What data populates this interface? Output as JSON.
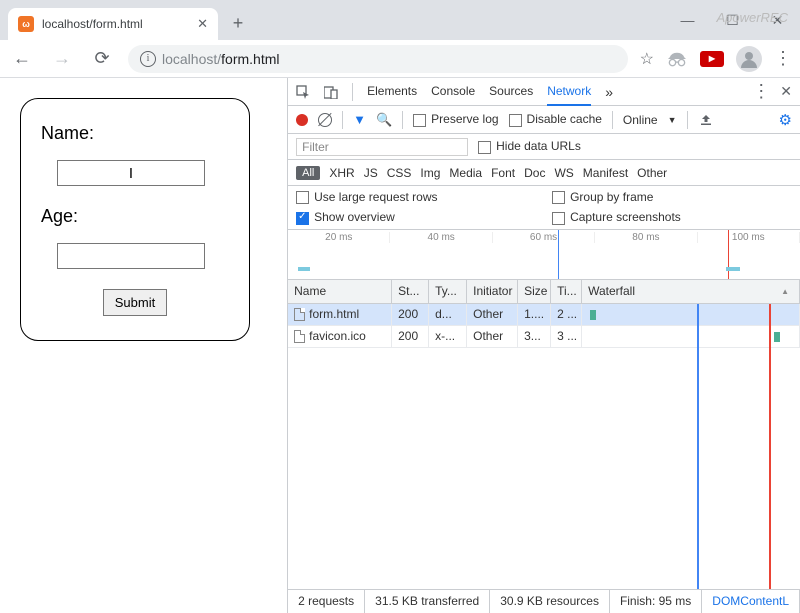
{
  "window": {
    "tab_title": "localhost/form.html",
    "watermark": "ApowerREC"
  },
  "toolbar": {
    "url_secure": "localhost/",
    "url_path": "form.html"
  },
  "page": {
    "name_label": "Name:",
    "age_label": "Age:",
    "submit_label": "Submit"
  },
  "devtools": {
    "tabs": {
      "elements": "Elements",
      "console": "Console",
      "sources": "Sources",
      "network": "Network"
    },
    "bar2": {
      "preserve_log": "Preserve log",
      "disable_cache": "Disable cache",
      "throttle": "Online"
    },
    "bar3": {
      "filter_placeholder": "Filter",
      "hide_data_urls": "Hide data URLs"
    },
    "filters": {
      "all": "All",
      "xhr": "XHR",
      "js": "JS",
      "css": "CSS",
      "img": "Img",
      "media": "Media",
      "font": "Font",
      "doc": "Doc",
      "ws": "WS",
      "manifest": "Manifest",
      "other": "Other"
    },
    "options": {
      "large_rows": "Use large request rows",
      "group_by_frame": "Group by frame",
      "show_overview": "Show overview",
      "capture_screenshots": "Capture screenshots"
    },
    "timeline_ticks": [
      "20 ms",
      "40 ms",
      "60 ms",
      "80 ms",
      "100 ms"
    ],
    "columns": {
      "name": "Name",
      "status": "St...",
      "type": "Ty...",
      "initiator": "Initiator",
      "size": "Size",
      "time": "Ti...",
      "waterfall": "Waterfall"
    },
    "requests": [
      {
        "name": "form.html",
        "status": "200",
        "type": "d...",
        "initiator": "Other",
        "size": "1....",
        "time": "2 ..."
      },
      {
        "name": "favicon.ico",
        "status": "200",
        "type": "x-...",
        "initiator": "Other",
        "size": "3...",
        "time": "3 ..."
      }
    ],
    "status": {
      "requests": "2 requests",
      "transferred": "31.5 KB transferred",
      "resources": "30.9 KB resources",
      "finish": "Finish: 95 ms",
      "domcontent": "DOMContentL"
    }
  }
}
